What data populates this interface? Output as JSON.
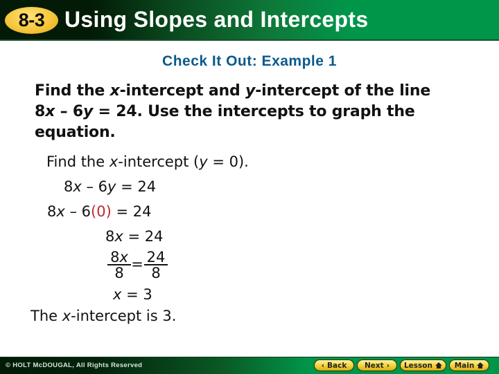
{
  "header": {
    "lesson_badge": "8-3",
    "title": "Using Slopes and Intercepts"
  },
  "subtitle": "Check It Out: Example 1",
  "problem": {
    "line1_a": "Find the ",
    "line1_x": "x",
    "line1_b": "-intercept and ",
    "line1_y": "y",
    "line1_c": "-intercept of the line",
    "line2_a": "8",
    "line2_x": "x",
    "line2_b": " – 6",
    "line2_y": "y",
    "line2_c": " = 24. Use the intercepts to graph the",
    "line3": "equation."
  },
  "work": {
    "step0_a": "Find the ",
    "step0_x": "x",
    "step0_b": "-intercept (",
    "step0_y": "y",
    "step0_c": " = 0).",
    "step1_a": "8",
    "step1_x": "x",
    "step1_b": " – 6",
    "step1_y": "y",
    "step1_c": " = 24",
    "step2_a": "8",
    "step2_x": "x",
    "step2_b": " – 6",
    "step2_red": "(0)",
    "step2_c": " = 24",
    "step3_a": "8",
    "step3_x": "x",
    "step3_b": " = 24",
    "frac_left_num_a": "8",
    "frac_left_num_x": "x",
    "frac_left_den": "8",
    "frac_eq": "=",
    "frac_right_num": "24",
    "frac_right_den": "8",
    "step5_x": "x",
    "step5_b": " = 3",
    "result_a": "The ",
    "result_x": "x",
    "result_b": "-intercept is 3."
  },
  "footer": {
    "copyright": "© HOLT McDOUGAL, All Rights Reserved",
    "back": "Back",
    "back_icon": "‹",
    "next": "Next",
    "next_icon": "›",
    "lesson": "Lesson",
    "main": "Main"
  },
  "colors": {
    "header_green": "#00964a",
    "badge_yellow": "#f6c63a",
    "subtitle_blue": "#0b5a8a",
    "highlight_red": "#c0282c"
  }
}
